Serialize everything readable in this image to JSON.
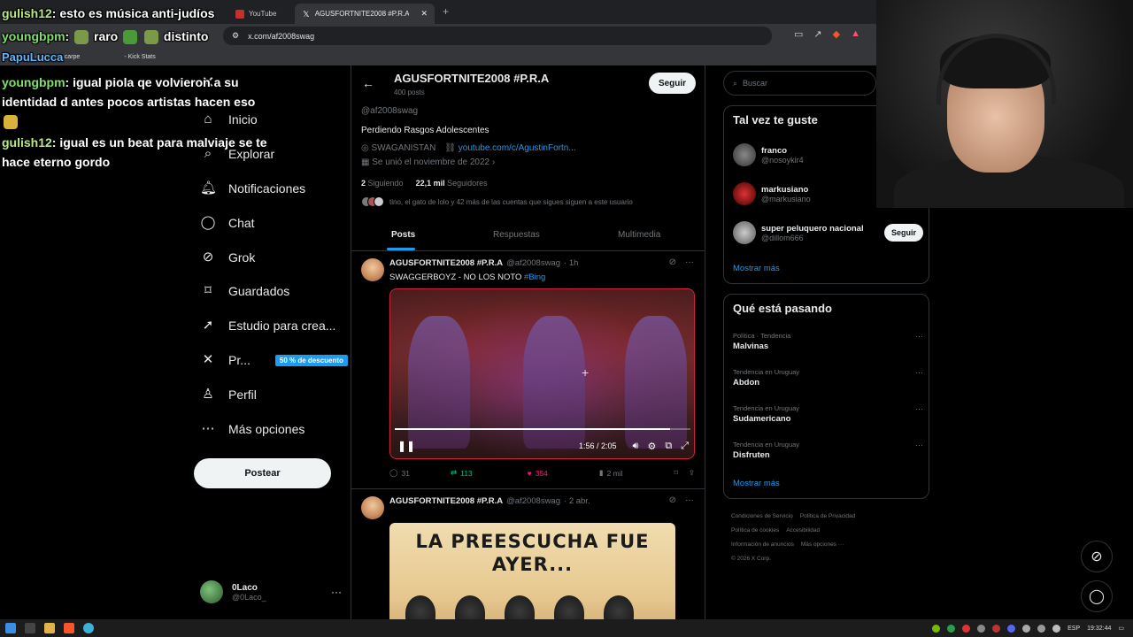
{
  "browser": {
    "tabs": [
      {
        "label": "YouTube",
        "active": false
      },
      {
        "label": "AGUSFORTNITE2008 #P.R.A (",
        "active": true
      }
    ],
    "url": "x.com/af2008swag",
    "bookmarks": [
      "Nueva carpe",
      "- Kick Stats"
    ]
  },
  "nav": {
    "items": [
      {
        "icon": "home-icon",
        "label": "Inicio"
      },
      {
        "icon": "search-icon",
        "label": "Explorar"
      },
      {
        "icon": "bell-icon",
        "label": "Notificaciones"
      },
      {
        "icon": "chat-icon",
        "label": "Chat"
      },
      {
        "icon": "grok-icon",
        "label": "Grok"
      },
      {
        "icon": "bookmark-icon",
        "label": "Guardados"
      },
      {
        "icon": "rocket-icon",
        "label": "Estudio para crea..."
      },
      {
        "icon": "x-logo-icon",
        "label": "Pr..."
      },
      {
        "icon": "person-icon",
        "label": "Perfil"
      },
      {
        "icon": "more-circle-icon",
        "label": "Más opciones"
      }
    ],
    "promo_badge": "50 % de descuento",
    "post_button": "Postear",
    "account": {
      "name": "0Laco",
      "handle": "@0Laco_"
    }
  },
  "profile": {
    "title": "AGUSFORTNITE2008 #P.R.A",
    "posts_count": "400 posts",
    "follow_label": "Seguir",
    "handle": "@af2008swag",
    "bio": "Perdiendo Rasgos Adolescentes",
    "location": "SWAGANISTAN",
    "link": "youtube.com/c/AgustinFortn...",
    "joined": "Se unió el noviembre de 2022",
    "following_count": "2",
    "following_label": "Siguiendo",
    "followers_count": "22,1 mil",
    "followers_label": "Seguidores",
    "mutuals_text": "tino, el gato de lolo y 42 más de las cuentas que sigues siguen a este usuario",
    "tabs": [
      "Posts",
      "Respuestas",
      "Multimedia"
    ]
  },
  "posts": [
    {
      "name": "AGUSFORTNITE2008 #P.R.A",
      "handle": "@af2008swag",
      "time": "· 1h",
      "text": "SWAGGERBOYZ - NO LOS NOTO",
      "hashtag": "#Bing",
      "video_time": "1:56 / 2:05",
      "video_progress": 0.93,
      "replies": "31",
      "reposts": "113",
      "likes": "354",
      "views": "2 mil"
    },
    {
      "name": "AGUSFORTNITE2008 #P.R.A",
      "handle": "@af2008swag",
      "time": "· 2 abr.",
      "image_text_line1": "LA PREESCUCHA FUE",
      "image_text_line2": "AYER..."
    }
  ],
  "sidebar": {
    "search_placeholder": "Buscar",
    "suggest_title": "Tal vez te guste",
    "suggestions": [
      {
        "name": "franco",
        "handle": "@nosoykir4"
      },
      {
        "name": "markusiano",
        "handle": "@markusiano"
      },
      {
        "name": "super peluquero nacional",
        "handle": "@dillom666",
        "button": "Seguir"
      }
    ],
    "show_more": "Mostrar más",
    "trends_title": "Qué está pasando",
    "trends": [
      {
        "category": "Política · Tendencia",
        "topic": "Malvinas"
      },
      {
        "category": "Tendencia en Uruguay",
        "topic": "Abdon"
      },
      {
        "category": "Tendencia en Uruguay",
        "topic": "Sudamericano"
      },
      {
        "category": "Tendencia en Uruguay",
        "topic": "Disfruten"
      }
    ],
    "trends_more": "Mostrar más",
    "footer": {
      "line1a": "Condiciones de Servicio",
      "line1b": "Política de Privacidad",
      "line2a": "Política de cookies",
      "line2b": "Accesibilidad",
      "line3a": "Información de anuncios",
      "line3b": "Más opciones ···",
      "line4": "© 2026 X Corp."
    }
  },
  "chat": [
    {
      "user": "gulish12",
      "text": " esto es música anti-judíos"
    },
    {
      "user": "youngbpm",
      "text": " raro",
      "text2": " distinto"
    },
    {
      "user": "PapuLucca",
      "text": ""
    },
    {
      "user": "youngbpm",
      "text": " igual piola qe volvieron a su identidad d antes pocos artistas hacen eso"
    },
    {
      "user": "gulish12",
      "text": " igual es un beat para malviaje se te hace eterno gordo"
    }
  ],
  "taskbar": {
    "lang": "ESP",
    "clock": "19:32:44"
  },
  "colors": {
    "accent": "#1d9bf0",
    "repost": "#00ba7c",
    "like": "#f91880",
    "bg": "#000000"
  }
}
